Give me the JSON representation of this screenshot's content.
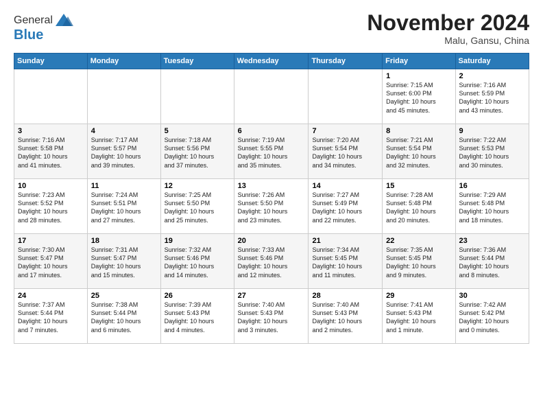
{
  "header": {
    "logo_general": "General",
    "logo_blue": "Blue",
    "month_title": "November 2024",
    "location": "Malu, Gansu, China"
  },
  "days_of_week": [
    "Sunday",
    "Monday",
    "Tuesday",
    "Wednesday",
    "Thursday",
    "Friday",
    "Saturday"
  ],
  "weeks": [
    [
      {
        "day": "",
        "info": ""
      },
      {
        "day": "",
        "info": ""
      },
      {
        "day": "",
        "info": ""
      },
      {
        "day": "",
        "info": ""
      },
      {
        "day": "",
        "info": ""
      },
      {
        "day": "1",
        "info": "Sunrise: 7:15 AM\nSunset: 6:00 PM\nDaylight: 10 hours\nand 45 minutes."
      },
      {
        "day": "2",
        "info": "Sunrise: 7:16 AM\nSunset: 5:59 PM\nDaylight: 10 hours\nand 43 minutes."
      }
    ],
    [
      {
        "day": "3",
        "info": "Sunrise: 7:16 AM\nSunset: 5:58 PM\nDaylight: 10 hours\nand 41 minutes."
      },
      {
        "day": "4",
        "info": "Sunrise: 7:17 AM\nSunset: 5:57 PM\nDaylight: 10 hours\nand 39 minutes."
      },
      {
        "day": "5",
        "info": "Sunrise: 7:18 AM\nSunset: 5:56 PM\nDaylight: 10 hours\nand 37 minutes."
      },
      {
        "day": "6",
        "info": "Sunrise: 7:19 AM\nSunset: 5:55 PM\nDaylight: 10 hours\nand 35 minutes."
      },
      {
        "day": "7",
        "info": "Sunrise: 7:20 AM\nSunset: 5:54 PM\nDaylight: 10 hours\nand 34 minutes."
      },
      {
        "day": "8",
        "info": "Sunrise: 7:21 AM\nSunset: 5:54 PM\nDaylight: 10 hours\nand 32 minutes."
      },
      {
        "day": "9",
        "info": "Sunrise: 7:22 AM\nSunset: 5:53 PM\nDaylight: 10 hours\nand 30 minutes."
      }
    ],
    [
      {
        "day": "10",
        "info": "Sunrise: 7:23 AM\nSunset: 5:52 PM\nDaylight: 10 hours\nand 28 minutes."
      },
      {
        "day": "11",
        "info": "Sunrise: 7:24 AM\nSunset: 5:51 PM\nDaylight: 10 hours\nand 27 minutes."
      },
      {
        "day": "12",
        "info": "Sunrise: 7:25 AM\nSunset: 5:50 PM\nDaylight: 10 hours\nand 25 minutes."
      },
      {
        "day": "13",
        "info": "Sunrise: 7:26 AM\nSunset: 5:50 PM\nDaylight: 10 hours\nand 23 minutes."
      },
      {
        "day": "14",
        "info": "Sunrise: 7:27 AM\nSunset: 5:49 PM\nDaylight: 10 hours\nand 22 minutes."
      },
      {
        "day": "15",
        "info": "Sunrise: 7:28 AM\nSunset: 5:48 PM\nDaylight: 10 hours\nand 20 minutes."
      },
      {
        "day": "16",
        "info": "Sunrise: 7:29 AM\nSunset: 5:48 PM\nDaylight: 10 hours\nand 18 minutes."
      }
    ],
    [
      {
        "day": "17",
        "info": "Sunrise: 7:30 AM\nSunset: 5:47 PM\nDaylight: 10 hours\nand 17 minutes."
      },
      {
        "day": "18",
        "info": "Sunrise: 7:31 AM\nSunset: 5:47 PM\nDaylight: 10 hours\nand 15 minutes."
      },
      {
        "day": "19",
        "info": "Sunrise: 7:32 AM\nSunset: 5:46 PM\nDaylight: 10 hours\nand 14 minutes."
      },
      {
        "day": "20",
        "info": "Sunrise: 7:33 AM\nSunset: 5:46 PM\nDaylight: 10 hours\nand 12 minutes."
      },
      {
        "day": "21",
        "info": "Sunrise: 7:34 AM\nSunset: 5:45 PM\nDaylight: 10 hours\nand 11 minutes."
      },
      {
        "day": "22",
        "info": "Sunrise: 7:35 AM\nSunset: 5:45 PM\nDaylight: 10 hours\nand 9 minutes."
      },
      {
        "day": "23",
        "info": "Sunrise: 7:36 AM\nSunset: 5:44 PM\nDaylight: 10 hours\nand 8 minutes."
      }
    ],
    [
      {
        "day": "24",
        "info": "Sunrise: 7:37 AM\nSunset: 5:44 PM\nDaylight: 10 hours\nand 7 minutes."
      },
      {
        "day": "25",
        "info": "Sunrise: 7:38 AM\nSunset: 5:44 PM\nDaylight: 10 hours\nand 6 minutes."
      },
      {
        "day": "26",
        "info": "Sunrise: 7:39 AM\nSunset: 5:43 PM\nDaylight: 10 hours\nand 4 minutes."
      },
      {
        "day": "27",
        "info": "Sunrise: 7:40 AM\nSunset: 5:43 PM\nDaylight: 10 hours\nand 3 minutes."
      },
      {
        "day": "28",
        "info": "Sunrise: 7:40 AM\nSunset: 5:43 PM\nDaylight: 10 hours\nand 2 minutes."
      },
      {
        "day": "29",
        "info": "Sunrise: 7:41 AM\nSunset: 5:43 PM\nDaylight: 10 hours\nand 1 minute."
      },
      {
        "day": "30",
        "info": "Sunrise: 7:42 AM\nSunset: 5:42 PM\nDaylight: 10 hours\nand 0 minutes."
      }
    ]
  ]
}
